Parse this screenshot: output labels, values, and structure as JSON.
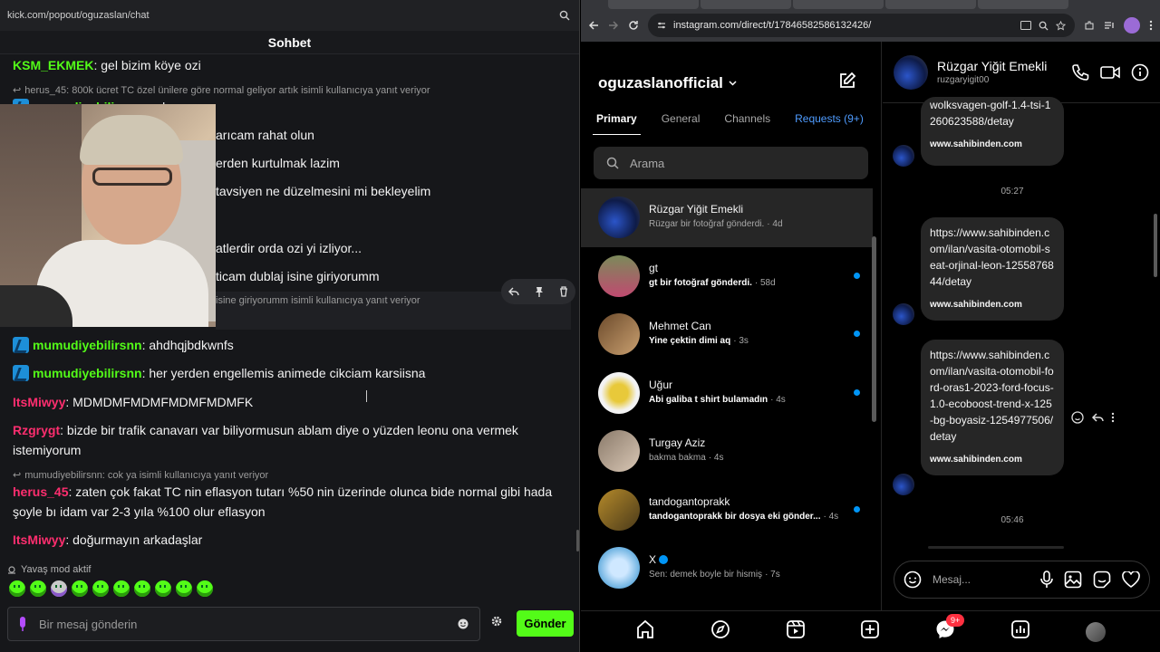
{
  "kick": {
    "url": "kick.com/popout/oguzaslan/chat",
    "header_title": "Sohbet",
    "messages": [
      {
        "user": "KSM_EKMEK",
        "color": "#53fc18",
        "text": "gel bizim köye ozi",
        "badge": false
      },
      {
        "user": "mumudiyebilirsnn",
        "color": "#53fc18",
        "text": "ahdhqjbdkwnfs",
        "badge": true
      },
      {
        "user": "mumudiyebilirsnn",
        "color": "#53fc18",
        "text": "her yerden engellemis animede cikciam karsiisna",
        "badge": true
      },
      {
        "user": "ItsMiwyy",
        "color": "#ff2e6f",
        "text": "MDMDMFMDMFMDMFMDMFK",
        "badge": false
      },
      {
        "user": "Rzgrygt",
        "color": "#ff2e6f",
        "text": "bizde bir trafik canavarı var biliyormusun ablam diye o yüzden leonu ona vermek istemiyorum",
        "badge": false
      },
      {
        "user": "herus_45",
        "color": "#ff2e6f",
        "text": "zaten çok fakat TC nin eflasyon tutarı %50 nin üzerinde olunca bide normal gibi hada şoyle bı idam var 2-3 yıla %100 olur eflasyon",
        "badge": false
      },
      {
        "user": "ItsMiwyy",
        "color": "#ff2e6f",
        "text": "doğurmayın arkadaşlar",
        "badge": false
      }
    ],
    "replies": [
      "herus_45: 800k ücret TC özel ünilere göre normal geliyor artık isimli kullanıcıya yanıt veriyor",
      "isine giriyorumm isimli kullanıcıya yanıt veriyor",
      "mumudiyebilirsnn: cok ya isimli kullanıcıya yanıt veriyor"
    ],
    "partial_user": "mumudiyebilirsnn",
    "partial_text": "cok ya",
    "covered_lines": [
      "arıcam rahat olun",
      "erden kurtulmak lazim",
      "tavsiyen ne düzelmesini mi bekleyelim",
      "atlerdir orda ozi yi izliyor...",
      "ticam dublaj isine giriyorumm"
    ],
    "slow_mode": "Yavaş mod aktif",
    "input_placeholder": "Bir mesaj gönderin",
    "send_label": "Gönder",
    "accent": "#53fc18"
  },
  "instagram": {
    "url": "instagram.com/direct/t/17846582586132426/",
    "account": "oguzaslanofficial",
    "tabs": [
      "Primary",
      "General",
      "Channels",
      "Requests (9+)"
    ],
    "search_placeholder": "Arama",
    "conversations": [
      {
        "name": "Rüzgar Yiğit Emekli",
        "preview": "Rüzgar bir fotoğraf gönderdi.",
        "time": "· 4d",
        "unread": false,
        "selected": true,
        "verified": false,
        "avatar": "radial-gradient(circle at 40% 60%,#2b55c9,#0e1b48 60%,#444 100%)"
      },
      {
        "name": "gt",
        "preview": "gt bir fotoğraf gönderdi.",
        "time": "· 58d",
        "unread": true,
        "selected": false,
        "verified": false,
        "avatar": "linear-gradient(180deg,#7b8a5a,#c04a70)"
      },
      {
        "name": "Mehmet Can",
        "preview": "Yine çektin dimi aq",
        "time": "· 3s",
        "unread": true,
        "selected": false,
        "verified": false,
        "avatar": "linear-gradient(135deg,#6b4a2b,#caa070)"
      },
      {
        "name": "Uğur",
        "preview": "Abi galiba t shirt bulamadın",
        "time": "· 4s",
        "unread": true,
        "selected": false,
        "verified": false,
        "avatar": "radial-gradient(circle,#e8c93a 30%,#f3f3f3 60%)"
      },
      {
        "name": "Turgay Aziz",
        "preview": "bakma bakma",
        "time": "· 4s",
        "unread": false,
        "selected": false,
        "verified": false,
        "avatar": "linear-gradient(135deg,#8a7a6a,#d9c7b5)"
      },
      {
        "name": "tandogantoprakk",
        "preview": "tandogantoprakk bir dosya eki gönder...",
        "time": "· 4s",
        "unread": true,
        "selected": false,
        "verified": false,
        "avatar": "linear-gradient(135deg,#b58a2a,#4a3a1a)"
      },
      {
        "name": "X",
        "preview": "Sen: demek boyle bir hismiş",
        "time": "· 7s",
        "unread": false,
        "selected": false,
        "verified": true,
        "avatar": "radial-gradient(circle,#cfe8ff 30%,#6ab0e0 70%)"
      }
    ],
    "thread": {
      "name": "Rüzgar Yiğit Emekli",
      "username": "ruzgaryigit00",
      "messages": [
        {
          "text": "wolksvagen-golf-1.4-tsi-1260623588/detay",
          "domain": "www.sahibinden.com"
        },
        {
          "text": "https://www.sahibinden.com/ilan/vasita-otomobil-seat-orjinal-leon-1255876844/detay",
          "domain": "www.sahibinden.com"
        },
        {
          "text": "https://www.sahibinden.com/ilan/vasita-otomobil-ford-oras1-2023-ford-focus-1.0-ecoboost-trend-x-125-bg-boyasiz-1254977506/detay",
          "domain": "www.sahibinden.com"
        }
      ],
      "times": [
        "05:27",
        "05:46"
      ],
      "composer_placeholder": "Mesaj..."
    },
    "notification_count": "9+",
    "accent": "#0095f6"
  }
}
